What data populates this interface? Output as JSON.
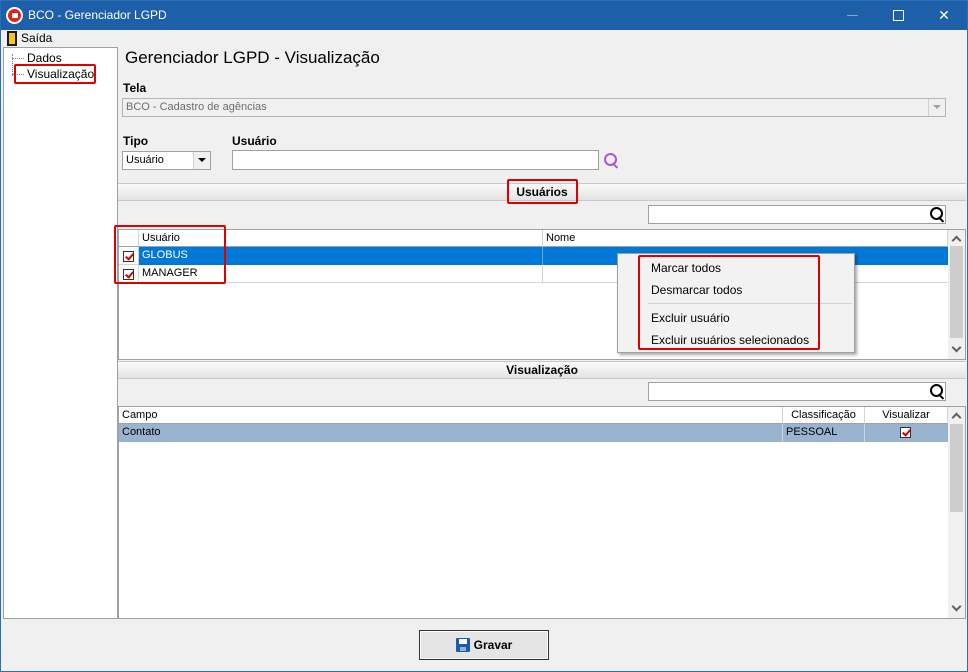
{
  "window": {
    "title": "BCO - Gerenciador LGPD",
    "min_symbol": "—",
    "close_symbol": "✕"
  },
  "menu": {
    "exit_label": "Saída"
  },
  "tree": {
    "items": [
      {
        "label": "Dados"
      },
      {
        "label": "Visualização"
      }
    ]
  },
  "page": {
    "title": "Gerenciador LGPD - Visualização"
  },
  "form": {
    "screen_label": "Tela",
    "screen_value": "BCO - Cadastro de agências",
    "type_label": "Tipo",
    "type_value": "Usuário",
    "user_label": "Usuário",
    "user_value": ""
  },
  "users_section": {
    "title": "Usuários",
    "search_value": "",
    "columns": [
      "Usuário",
      "Nome"
    ],
    "rows": [
      {
        "user": "GLOBUS",
        "name": "",
        "checked": true,
        "selected": true
      },
      {
        "user": "MANAGER",
        "name": "",
        "checked": true,
        "selected": false
      }
    ]
  },
  "context_menu": {
    "items": [
      "Marcar todos",
      "Desmarcar todos",
      "Excluir usuário",
      "Excluir usuários selecionados"
    ]
  },
  "view_section": {
    "title": "Visualização",
    "search_value": "",
    "columns": [
      "Campo",
      "Classificação",
      "Visualizar"
    ],
    "rows": [
      {
        "field": "Contato",
        "classification": "PESSOAL",
        "visualize": true
      }
    ]
  },
  "save_button": {
    "label": "Gravar"
  },
  "colors": {
    "titlebar": "#1d5fa9",
    "selection": "#0078d7",
    "selected_row_alt": "#99b4d1",
    "highlight_box": "#e00000",
    "search_icon_purple": "#a45bd6"
  }
}
